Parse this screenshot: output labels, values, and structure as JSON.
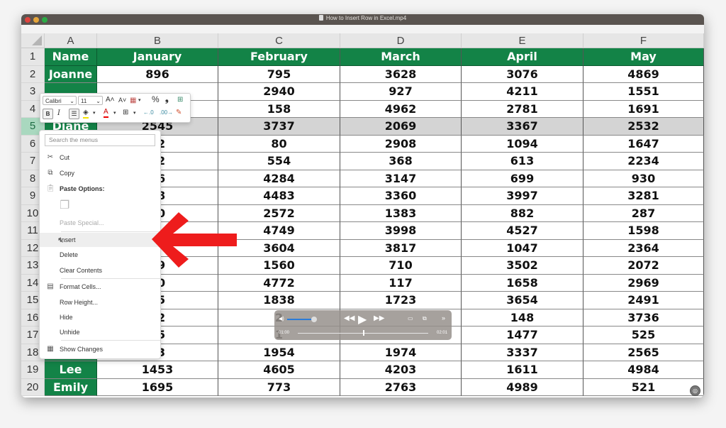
{
  "window": {
    "title": "How to Insert Row in Excel.mp4",
    "file_icon": "document-icon"
  },
  "sheet": {
    "column_letters": [
      "A",
      "B",
      "C",
      "D",
      "E",
      "F"
    ],
    "row_numbers": [
      "1",
      "2",
      "3",
      "4",
      "5",
      "6",
      "7",
      "8",
      "9",
      "10",
      "11",
      "12",
      "13",
      "14",
      "15",
      "16",
      "17",
      "18",
      "19",
      "20"
    ],
    "header": [
      "Name",
      "January",
      "February",
      "March",
      "April",
      "May"
    ],
    "selected_row": "5",
    "rows": [
      [
        "Joanne",
        "896",
        "795",
        "3628",
        "3076",
        "4869"
      ],
      [
        "",
        "",
        "2940",
        "927",
        "4211",
        "1551"
      ],
      [
        "",
        "",
        "158",
        "4962",
        "2781",
        "1691"
      ],
      [
        "Diane",
        "2545",
        "3737",
        "2069",
        "3367",
        "2532"
      ],
      [
        "",
        "72",
        "80",
        "2908",
        "1094",
        "1647"
      ],
      [
        "",
        "42",
        "554",
        "368",
        "613",
        "2234"
      ],
      [
        "",
        "26",
        "4284",
        "3147",
        "699",
        "930"
      ],
      [
        "",
        "68",
        "4483",
        "3360",
        "3997",
        "3281"
      ],
      [
        "",
        "90",
        "2572",
        "1383",
        "882",
        "287"
      ],
      [
        "",
        "",
        "4749",
        "3998",
        "4527",
        "1598"
      ],
      [
        "",
        "",
        "3604",
        "3817",
        "1047",
        "2364"
      ],
      [
        "",
        "89",
        "1560",
        "710",
        "3502",
        "2072"
      ],
      [
        "",
        "60",
        "4772",
        "117",
        "1658",
        "2969"
      ],
      [
        "",
        "35",
        "1838",
        "1723",
        "3654",
        "2491"
      ],
      [
        "",
        "82",
        "2",
        "",
        "148",
        "3736"
      ],
      [
        "",
        "65",
        "1",
        "",
        "1477",
        "525"
      ],
      [
        "",
        "03",
        "1954",
        "1974",
        "3337",
        "2565"
      ],
      [
        "Lee",
        "1453",
        "4605",
        "4203",
        "1611",
        "4984"
      ],
      [
        "Emily",
        "1695",
        "773",
        "2763",
        "4989",
        "521"
      ]
    ],
    "accent_color": "#138347"
  },
  "mini_toolbar": {
    "font_name": "Calibri",
    "font_size": "11",
    "increase_font": "A˄",
    "decrease_font": "A˅",
    "percent": "%",
    "comma": ")",
    "bold": "B",
    "italic": "I"
  },
  "context_menu": {
    "search_placeholder": "Search the menus",
    "items": [
      {
        "label": "Cut",
        "icon": "scissors-icon"
      },
      {
        "label": "Copy",
        "icon": "copy-icon"
      },
      {
        "label": "Paste Options:",
        "icon": "clipboard-icon"
      },
      {
        "label": "",
        "icon": "paste-icon"
      },
      {
        "label": "Paste Special...",
        "icon": ""
      },
      {
        "label": "Insert",
        "icon": ""
      },
      {
        "label": "Delete",
        "icon": ""
      },
      {
        "label": "Clear Contents",
        "icon": ""
      },
      {
        "label": "Format Cells...",
        "icon": "format-cells-icon"
      },
      {
        "label": "Row Height...",
        "icon": ""
      },
      {
        "label": "Hide",
        "icon": ""
      },
      {
        "label": "Unhide",
        "icon": ""
      },
      {
        "label": "Show Changes",
        "icon": "show-changes-icon"
      }
    ]
  },
  "video_controls": {
    "current_time": "01:00",
    "total_time": "02:01",
    "progress": 0.5,
    "volume": 0.8
  }
}
